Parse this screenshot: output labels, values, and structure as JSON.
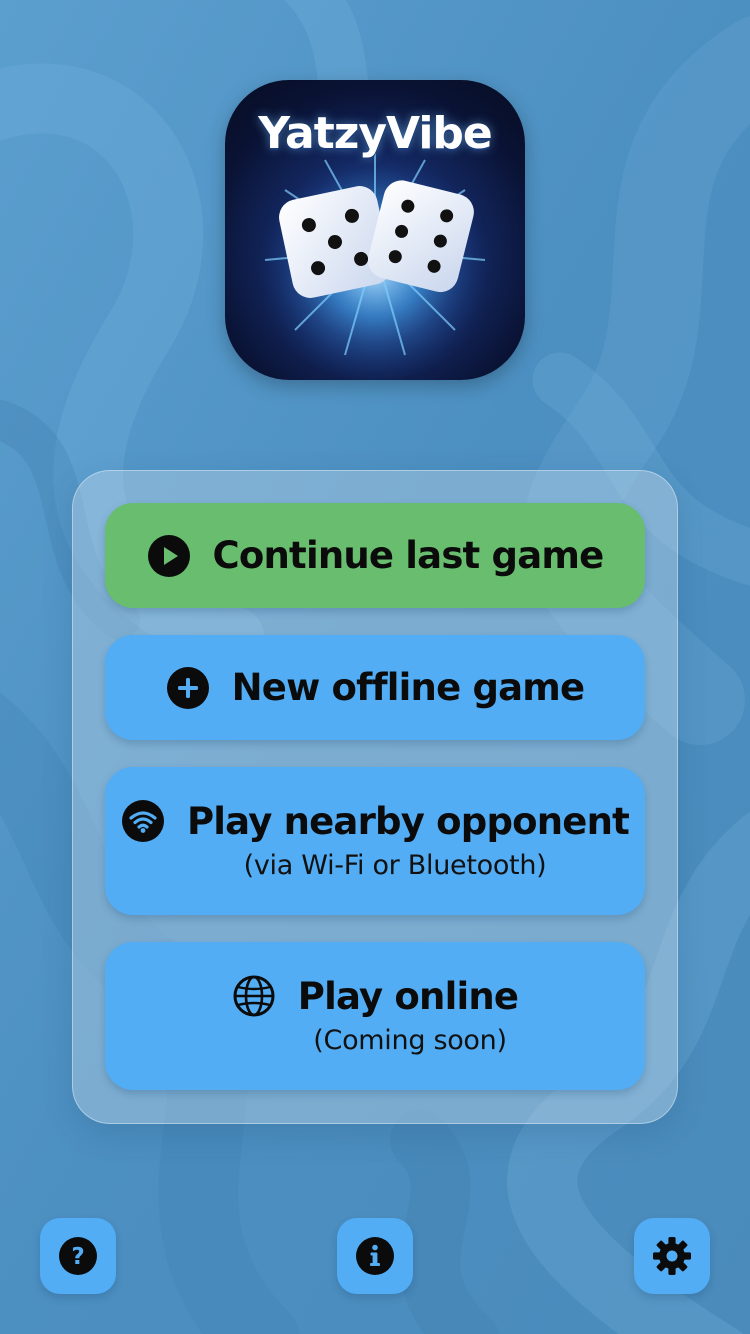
{
  "background": {
    "color": "#4f93c4"
  },
  "app_icon": {
    "title": "YatzyVibe"
  },
  "menu": {
    "buttons": [
      {
        "label": "Continue last game",
        "sublabel": "",
        "icon": "play-circle-icon",
        "color": "#68bd6e"
      },
      {
        "label": "New offline game",
        "sublabel": "",
        "icon": "plus-circle-icon",
        "color": "#52adf5"
      },
      {
        "label": "Play nearby opponent",
        "sublabel": "(via Wi-Fi or Bluetooth)",
        "icon": "wifi-icon",
        "color": "#52adf5"
      },
      {
        "label": "Play online",
        "sublabel": "(Coming soon)",
        "icon": "globe-icon",
        "color": "#52adf5"
      }
    ]
  },
  "bottom_bar": {
    "help_icon": "question-circle-icon",
    "info_icon": "info-circle-icon",
    "settings_icon": "gear-icon"
  }
}
